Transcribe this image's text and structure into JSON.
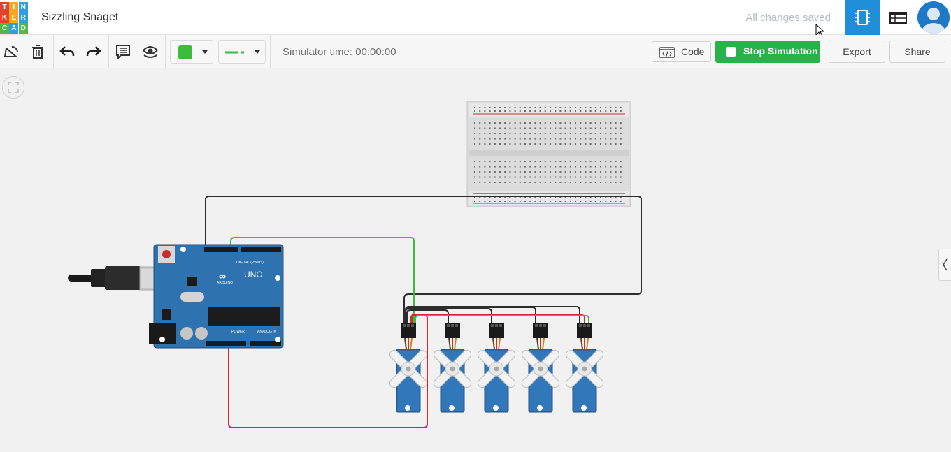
{
  "app": {
    "logo_letters": [
      "T",
      "I",
      "N",
      "K",
      "E",
      "R",
      "C",
      "A",
      "D"
    ],
    "logo_colors": [
      "#e2442f",
      "#f5a623",
      "#2e9fe0",
      "#e2442f",
      "#f5a623",
      "#2e9fe0",
      "#4fba47",
      "#2e9fe0",
      "#4fba47"
    ],
    "project_title": "Sizzling Snaget",
    "save_status": "All changes saved"
  },
  "toolbar": {
    "icons": [
      "rotate-icon",
      "trash-icon",
      "undo-icon",
      "redo-icon",
      "notes-icon",
      "visibility-icon"
    ],
    "color_swatch": "#3dbb3d",
    "sim_time": "Simulator time: 00:00:00",
    "code_label": "Code",
    "stop_label": "Stop Simulation",
    "export_label": "Export",
    "share_label": "Share"
  },
  "colors": {
    "accent": "#1e8fd8",
    "stop_green": "#27b24a",
    "wire_black": "#2d2d2d",
    "wire_red": "#d42a2a",
    "wire_green": "#3dbb3d",
    "wire_orange": "#e07a1d",
    "arduino_blue": "#2d6ca8"
  },
  "circuit": {
    "arduino_label": "UNO",
    "arduino_sub": "ARDUINO",
    "digital_label": "DIGITAL (PWM~)",
    "power_label": "POWER",
    "analog_label": "ANALOG IN",
    "servo_count": 5
  }
}
